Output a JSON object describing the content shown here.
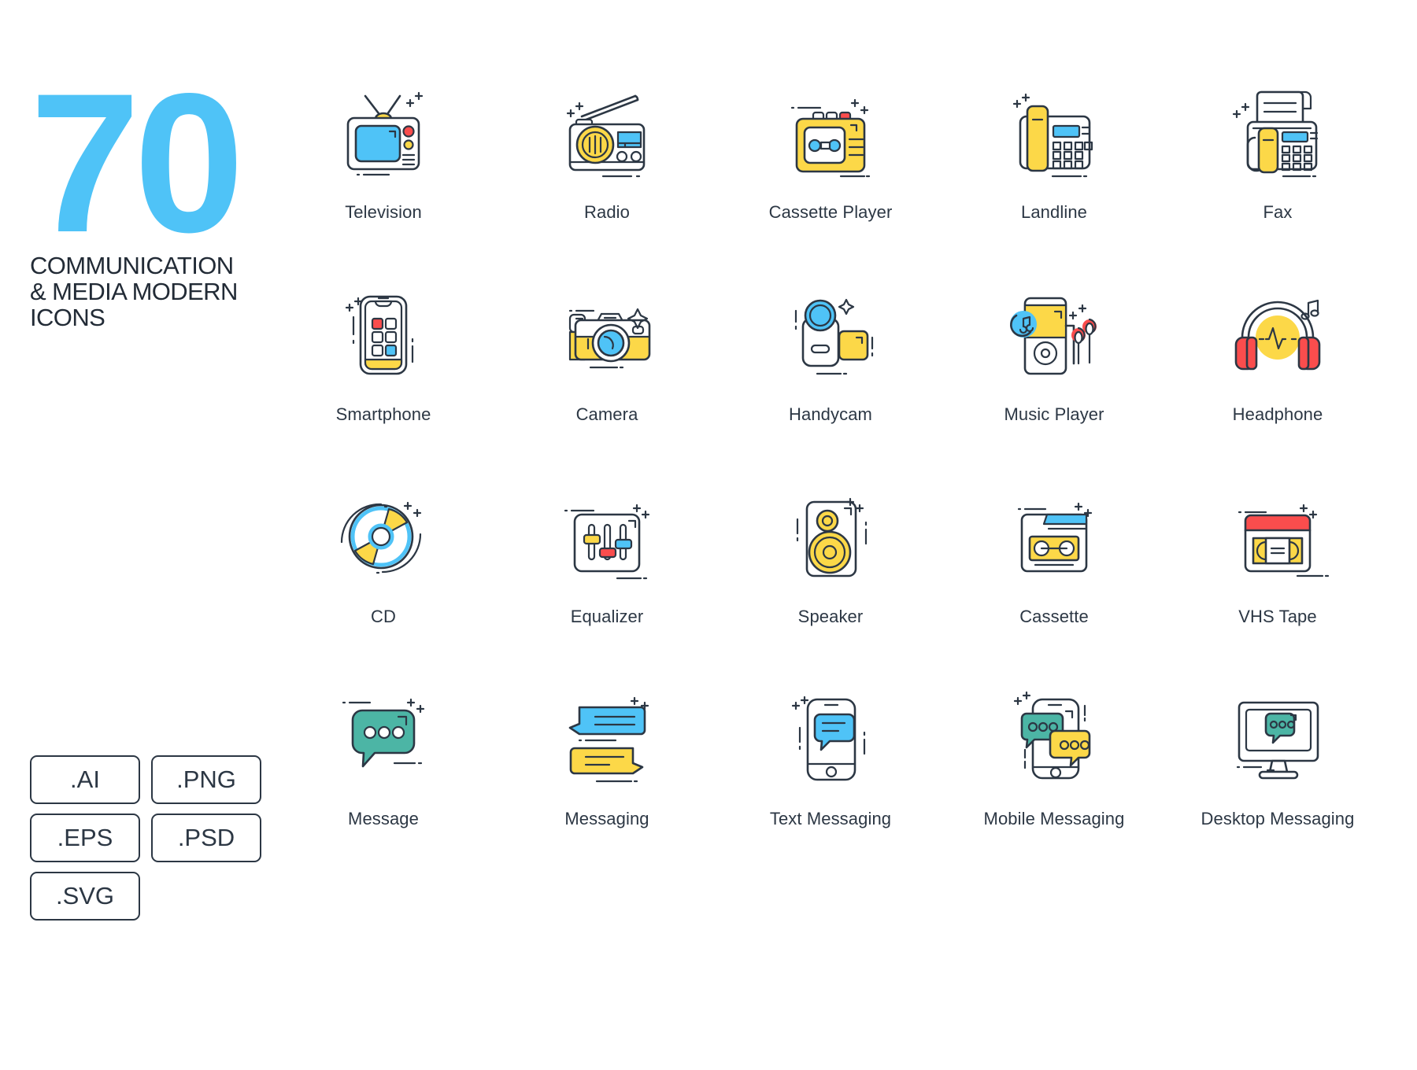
{
  "poster": {
    "count": "70",
    "title": "COMMUNICATION\n& MEDIA MODERN\nICONS",
    "accent_color": "#4FC3F7",
    "ink_color": "#2c3744"
  },
  "palette": {
    "yellow": "#FCD848",
    "cyan": "#4FC3F7",
    "red": "#FA4D4D",
    "teal": "#4CB5A5",
    "outline": "#2c3744",
    "background": "#ffffff"
  },
  "file_formats": [
    {
      "label": ".AI"
    },
    {
      "label": ".PNG"
    },
    {
      "label": ".EPS"
    },
    {
      "label": ".PSD"
    },
    {
      "label": ".SVG"
    }
  ],
  "icons": [
    {
      "name": "television",
      "label": "Television"
    },
    {
      "name": "radio",
      "label": "Radio"
    },
    {
      "name": "cassette-player",
      "label": "Cassette Player"
    },
    {
      "name": "landline",
      "label": "Landline"
    },
    {
      "name": "fax",
      "label": "Fax"
    },
    {
      "name": "smartphone",
      "label": "Smartphone"
    },
    {
      "name": "camera",
      "label": "Camera"
    },
    {
      "name": "handycam",
      "label": "Handycam"
    },
    {
      "name": "music-player",
      "label": "Music Player"
    },
    {
      "name": "headphone",
      "label": "Headphone"
    },
    {
      "name": "cd",
      "label": "CD"
    },
    {
      "name": "equalizer",
      "label": "Equalizer"
    },
    {
      "name": "speaker",
      "label": "Speaker"
    },
    {
      "name": "cassette",
      "label": "Cassette"
    },
    {
      "name": "vhs-tape",
      "label": "VHS Tape"
    },
    {
      "name": "message",
      "label": "Message"
    },
    {
      "name": "messaging",
      "label": "Messaging"
    },
    {
      "name": "text-messaging",
      "label": "Text Messaging"
    },
    {
      "name": "mobile-messaging",
      "label": "Mobile Messaging"
    },
    {
      "name": "desktop-messaging",
      "label": "Desktop Messaging"
    }
  ]
}
